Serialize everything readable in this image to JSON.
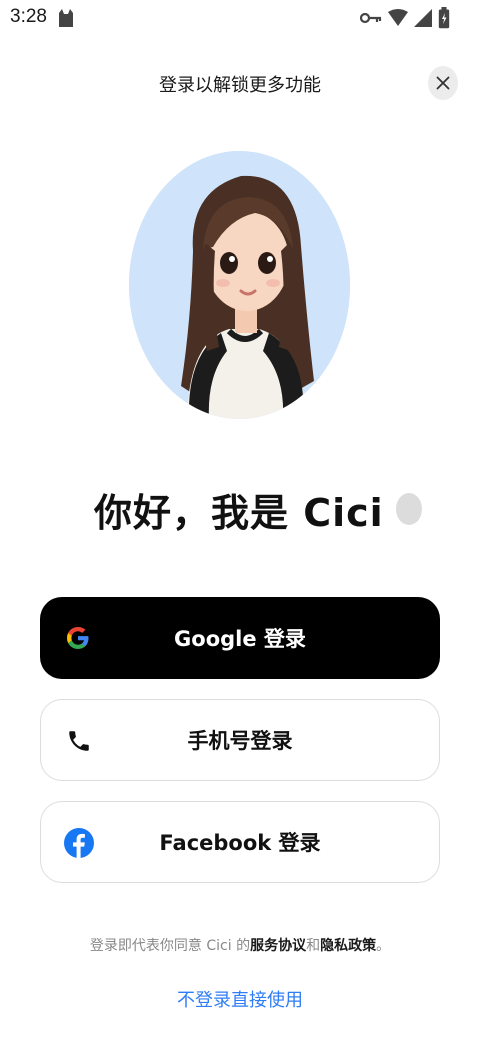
{
  "status_bar": {
    "time": "3:28"
  },
  "header": {
    "title": "登录以解锁更多功能"
  },
  "greeting": {
    "text": "你好，我是 Cici"
  },
  "login_buttons": [
    {
      "label": "Google 登录",
      "icon": "google-icon"
    },
    {
      "label": "手机号登录",
      "icon": "phone-icon"
    },
    {
      "label": "Facebook 登录",
      "icon": "facebook-icon"
    }
  ],
  "legal": {
    "prefix": "登录即代表你同意 Cici 的",
    "terms": "服务协议",
    "and": "和",
    "privacy": "隐私政策",
    "suffix": "。"
  },
  "skip": {
    "label": "不登录直接使用"
  },
  "colors": {
    "avatar_bg": "#cfe3fb",
    "google_button_bg": "#000000",
    "link_blue": "#2f7df6",
    "facebook_blue": "#1877f2"
  }
}
